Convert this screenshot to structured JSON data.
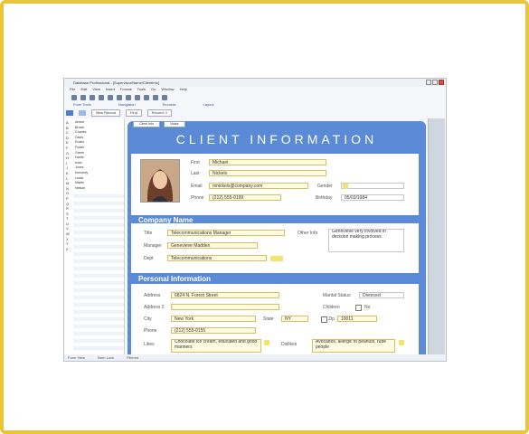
{
  "window": {
    "title": "Database Professional - [Supervisor/Name/ClientInfo]",
    "menus": [
      "File",
      "Edit",
      "View",
      "Insert",
      "Format",
      "Tools",
      "Go",
      "Window",
      "Help"
    ],
    "ribbon": [
      "Form Tools",
      "Navigation",
      "Records",
      "Layout"
    ]
  },
  "subbar": {
    "new_button": "New Record",
    "search_button": "Find",
    "status_label": "Record: 1"
  },
  "sidebar": {
    "letters": [
      "A",
      "B",
      "C",
      "D",
      "E",
      "F",
      "G",
      "H",
      "I",
      "J",
      "K",
      "L",
      "M",
      "N",
      "O",
      "P",
      "Q",
      "R",
      "S",
      "T",
      "U",
      "V",
      "W",
      "X",
      "Y",
      "Z"
    ],
    "names": [
      "Amber",
      "Brown",
      "Charles",
      "Davis",
      "Evans",
      "Foster",
      "Green",
      "Harris",
      "Irwin",
      "Jones",
      "Kennedy",
      "Lewis",
      "Martin",
      "Nelson",
      "Owens",
      "Parker",
      "Quinn"
    ]
  },
  "form": {
    "tabs": [
      "Client Info",
      "Notes"
    ],
    "heading": "CLIENT INFORMATION",
    "contact": {
      "first_label": "First",
      "first_value": "Michael",
      "last_label": "Last",
      "last_value": "Nickels",
      "email_label": "Email",
      "email_value": "mnickels@company.com",
      "phone_label": "Phone",
      "phone_value": "(212) 555-0199",
      "gender_label": "Gender",
      "birthday_label": "Birthday",
      "birthday_value": "05/03/1984"
    },
    "company": {
      "section_title": "Company Name",
      "title_label": "Title",
      "title_value": "Telecommunications Manager",
      "manager_label": "Manager",
      "manager_value": "Genevieve Madden",
      "dept_label": "Dept",
      "dept_value": "Telecommunications",
      "other_label": "Other Info",
      "other_value": "Genevieve very involved in decision making process"
    },
    "personal": {
      "section_title": "Personal Information",
      "address_label": "Address",
      "address_value": "6824 N. Forest Street",
      "address2_label": "Address 2",
      "city_label": "City",
      "city_value": "New York",
      "state_label": "State",
      "state_value": "NY",
      "phone_label": "Phone",
      "phone_value": "(212) 555-0155",
      "likes_label": "Likes",
      "likes_value": "Chocolate ice cream, educated and good manners",
      "marital_label": "Marital Status",
      "marital_value": "Divorced",
      "children_label": "Children",
      "children_value": "No",
      "zip_label": "Zip",
      "zip_value": "10011",
      "dislikes_label": "Dislikes",
      "dislikes_value": "Avocados, allergic to peanuts, rude people"
    }
  },
  "status": [
    "Form View",
    "Num Lock",
    "Filtered"
  ],
  "colors": {
    "frame": "#e9c53a",
    "form_bg": "#5b8ad6",
    "field_highlight": "#fffbe0"
  }
}
